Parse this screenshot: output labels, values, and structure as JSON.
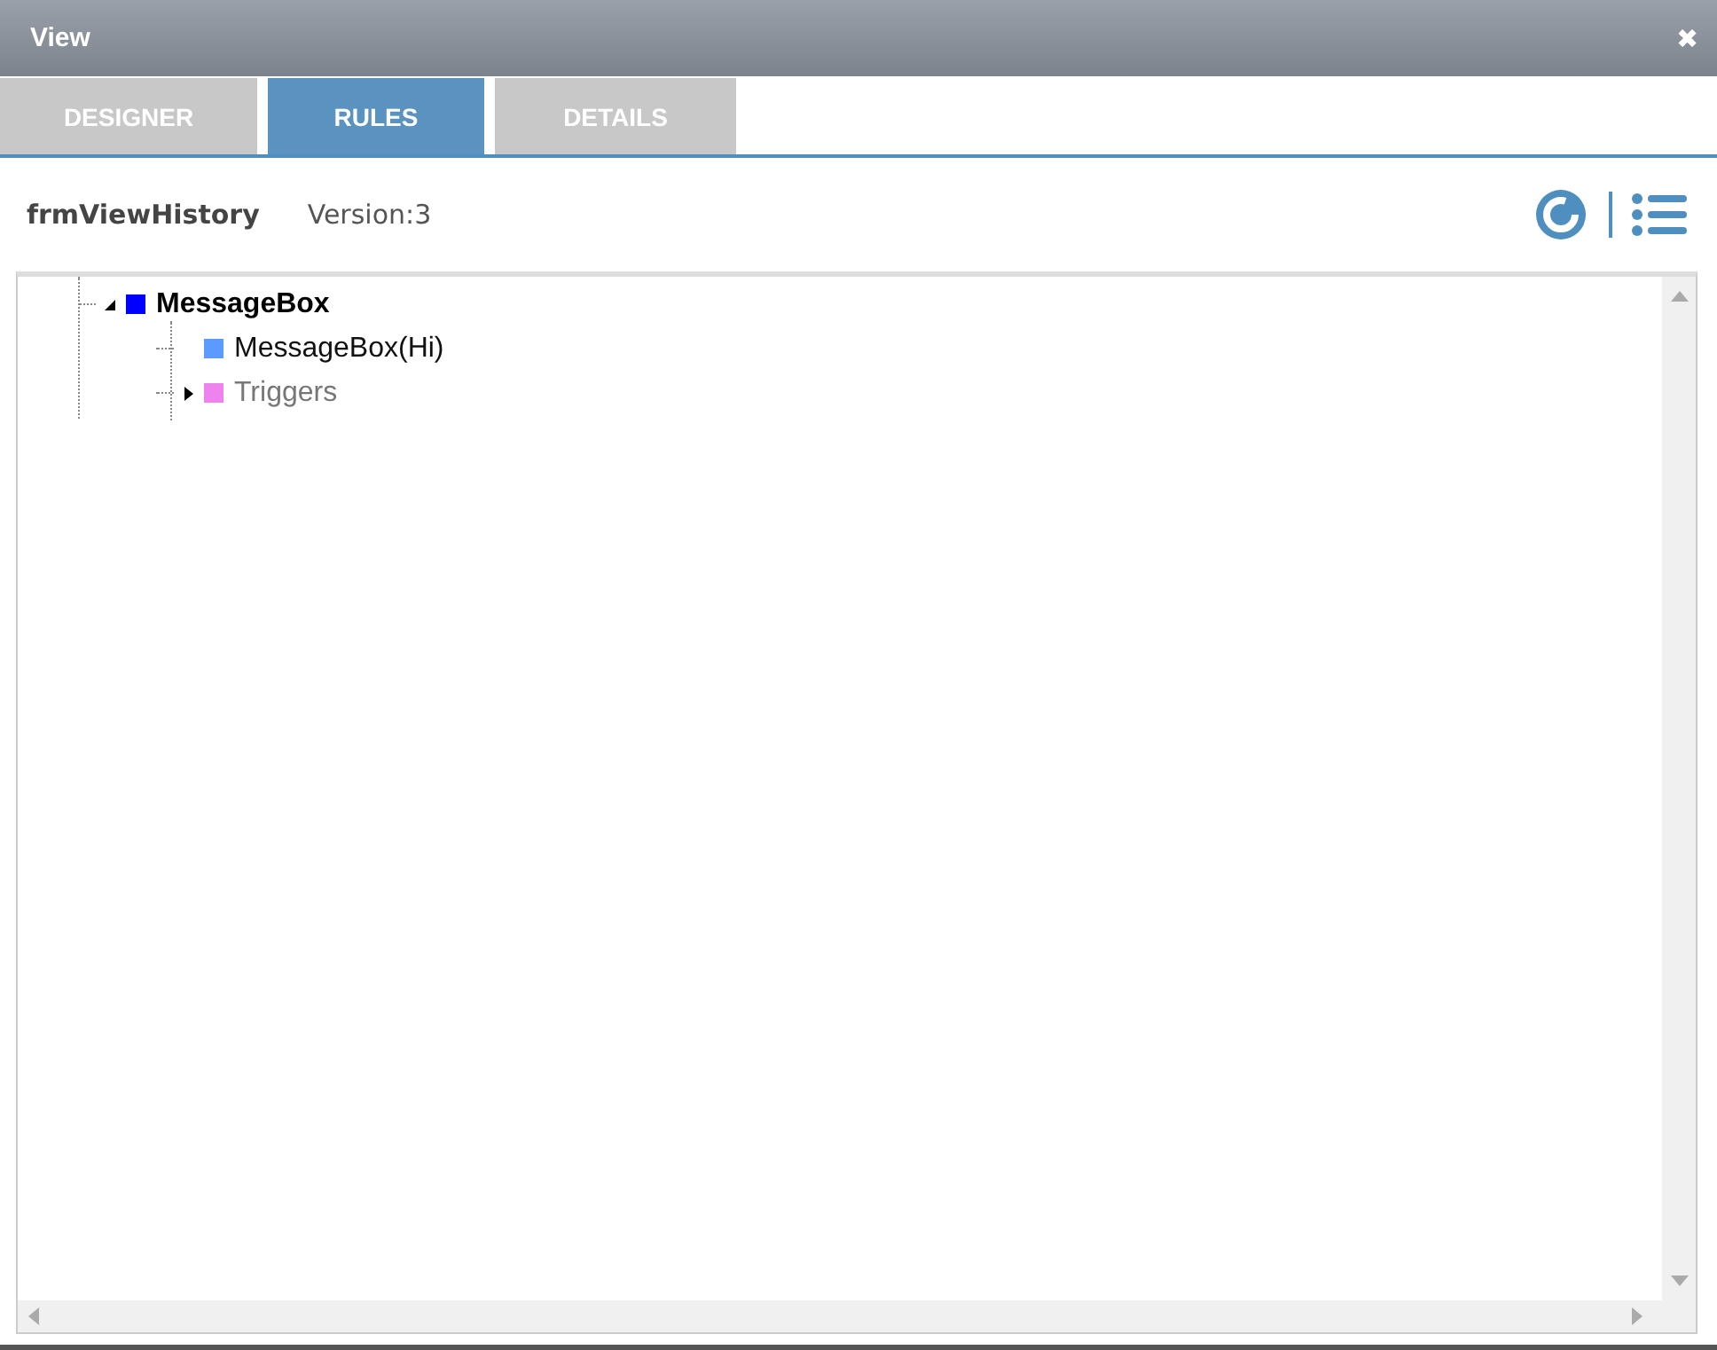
{
  "window": {
    "title": "View",
    "close": "✖"
  },
  "tabs": [
    {
      "label": "DESIGNER",
      "selected": false
    },
    {
      "label": "RULES",
      "selected": true
    },
    {
      "label": "DETAILS",
      "selected": false
    }
  ],
  "header": {
    "form_name": "frmViewHistory",
    "version": "Version:3"
  },
  "tree": [
    {
      "label": "MessageBox",
      "bold": true,
      "color": "#0000ff",
      "expanded": true,
      "disabled": false,
      "children": [
        {
          "label": "MessageBox(Hi)",
          "bold": false,
          "color": "#5b9bff",
          "disabled": false
        },
        {
          "label": "Triggers",
          "bold": false,
          "color": "#ee82ee",
          "expanded": false,
          "disabled": true
        }
      ]
    }
  ]
}
